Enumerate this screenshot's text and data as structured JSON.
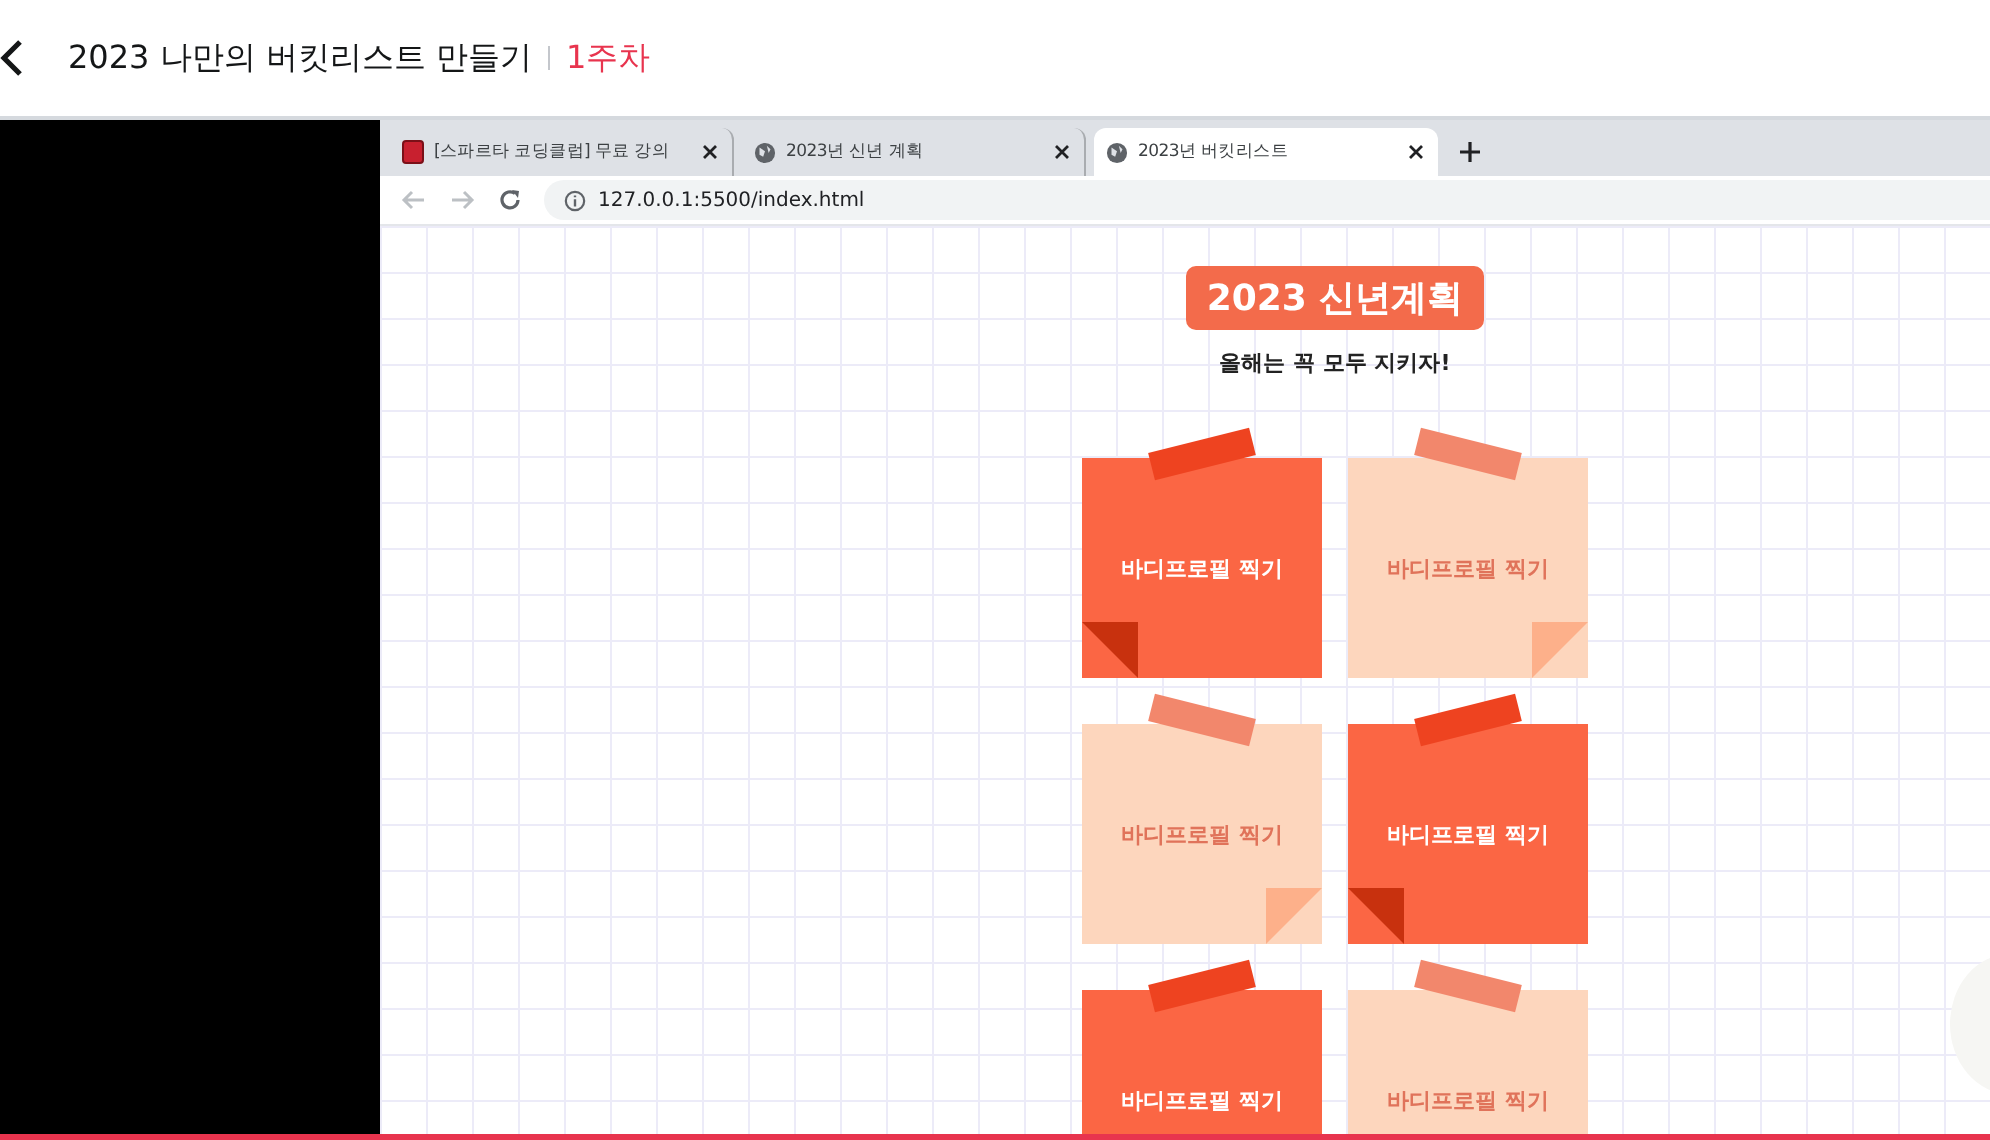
{
  "header": {
    "title": "2023 나만의 버킷리스트 만들기",
    "week": "1주차"
  },
  "browser": {
    "tabs": [
      {
        "title": "[스파르타 코딩클럽] 무료 강의",
        "kind": "book",
        "selected": false
      },
      {
        "title": "2023년 신년 계획",
        "kind": "globe",
        "selected": false
      },
      {
        "title": "2023년 버킷리스트",
        "kind": "globe",
        "selected": true
      }
    ],
    "url": "127.0.0.1:5500/index.html"
  },
  "page": {
    "title": "2023 신년계획",
    "subtitle": "올해는 꼭 모두 지키자!",
    "notes": [
      {
        "text": "바디프로필 찍기",
        "kind": "dark",
        "folded": true
      },
      {
        "text": "바디프로필 찍기",
        "kind": "light",
        "folded": true
      },
      {
        "text": "바디프로필 찍기",
        "kind": "light",
        "folded": true
      },
      {
        "text": "바디프로필 찍기",
        "kind": "dark",
        "folded": true
      },
      {
        "text": "바디프로필 찍기",
        "kind": "dark",
        "folded": false
      },
      {
        "text": "바디프로필 찍기",
        "kind": "light",
        "folded": false
      }
    ]
  }
}
